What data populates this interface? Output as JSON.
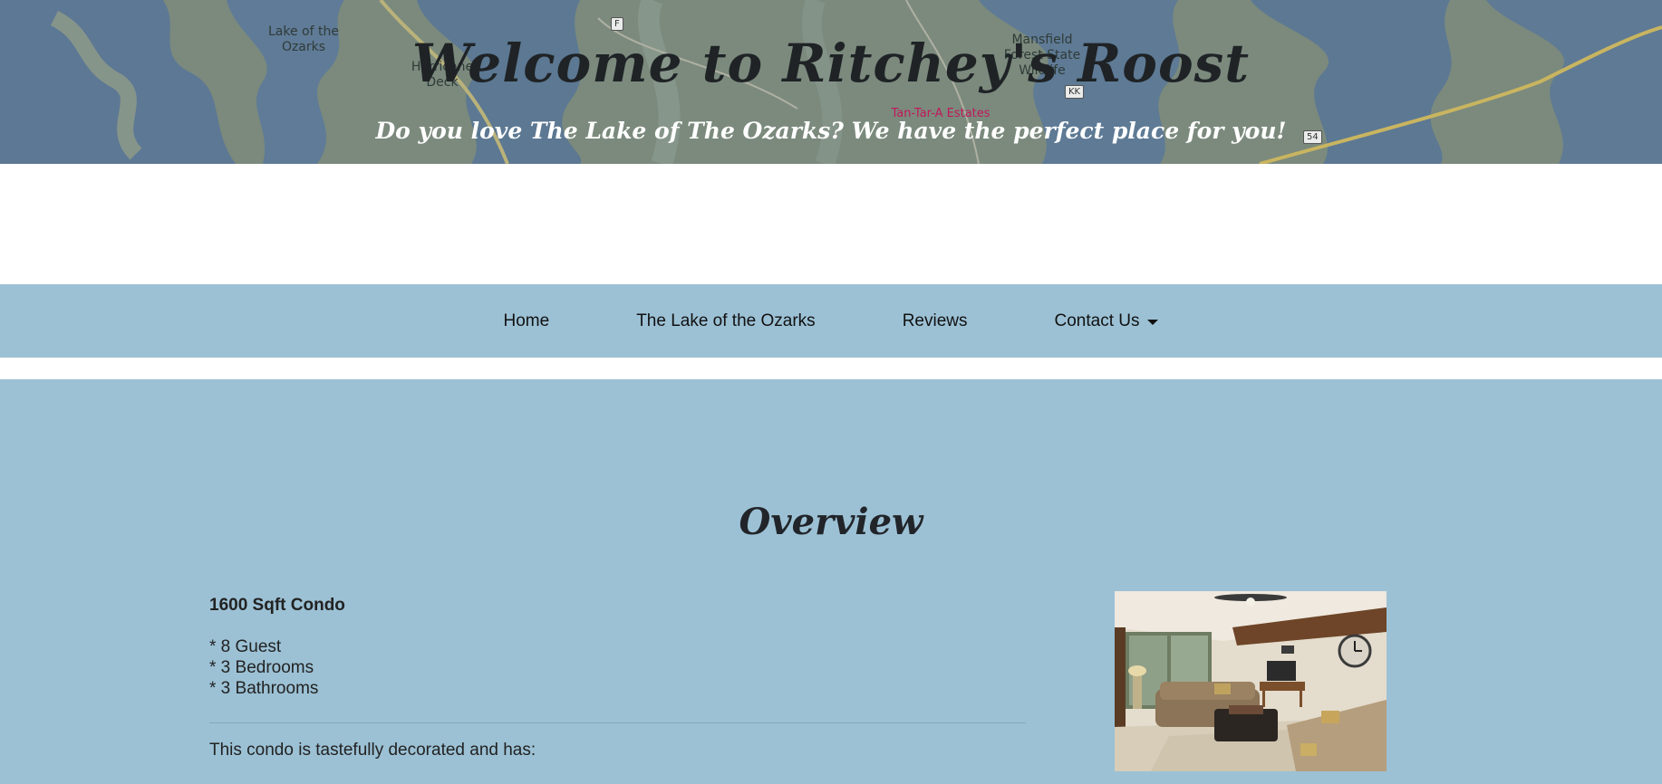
{
  "hero": {
    "title": "Welcome to Ritchey's Roost",
    "subtitle": "Do you love The Lake of The Ozarks? We have the perfect place for you!",
    "map_labels": [
      "Lake of the Ozarks",
      "Hurricane Deck",
      "Mansfield Forest State Wildlife",
      "Tan-Tar-A Estates"
    ],
    "road_shields": [
      "F",
      "KK",
      "54"
    ]
  },
  "nav": {
    "items": [
      {
        "label": "Home"
      },
      {
        "label": "The Lake of the Ozarks"
      },
      {
        "label": "Reviews"
      },
      {
        "label": "Contact Us"
      }
    ]
  },
  "overview": {
    "title": "Overview",
    "heading": "1600 Sqft Condo",
    "features": [
      "* 8 Guest",
      "* 3 Bedrooms",
      "* 3 Bathrooms"
    ],
    "intro": "This condo is tastefully decorated and has:"
  },
  "colors": {
    "section_bg": "#9cc1d5",
    "title_dark": "#1f2326",
    "subtitle_white": "#ffffff"
  }
}
